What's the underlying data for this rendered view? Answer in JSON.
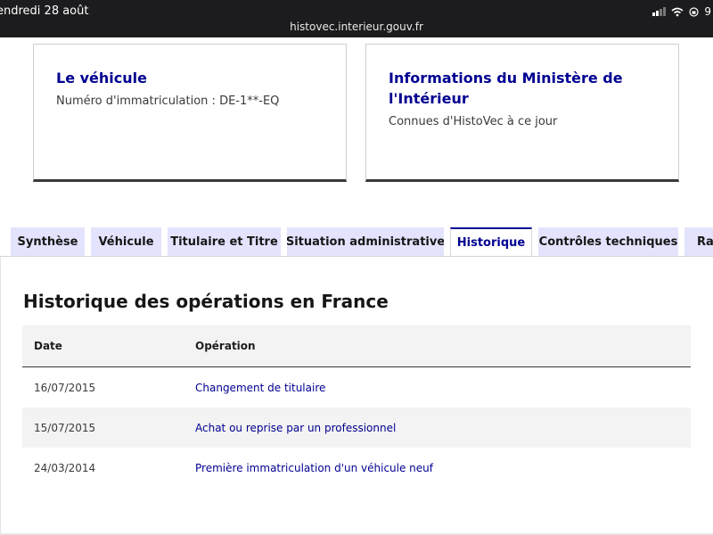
{
  "statusbar": {
    "time": "endredi 28 août",
    "url": "histovec.interieur.gouv.fr",
    "battery": "9"
  },
  "cards": [
    {
      "title": "Le véhicule",
      "text": "Numéro d'immatriculation : DE-1**-EQ"
    },
    {
      "title": "Informations du Ministère de l'Intérieur",
      "text": "Connues d'HistoVec à ce jour"
    }
  ],
  "tabs": [
    {
      "label": "Synthèse",
      "active": false
    },
    {
      "label": "Véhicule",
      "active": false
    },
    {
      "label": "Titulaire et Titre",
      "active": false
    },
    {
      "label": "Situation administrative",
      "active": false
    },
    {
      "label": "Historique",
      "active": true
    },
    {
      "label": "Contrôles techniques",
      "active": false
    },
    {
      "label": "Ra",
      "active": false
    }
  ],
  "history": {
    "title": "Historique des opérations en France",
    "columns": {
      "date": "Date",
      "operation": "Opération"
    },
    "rows": [
      {
        "date": "16/07/2015",
        "operation": "Changement de titulaire"
      },
      {
        "date": "15/07/2015",
        "operation": "Achat ou reprise par un professionnel"
      },
      {
        "date": "24/03/2014",
        "operation": "Première immatriculation d'un véhicule neuf"
      }
    ]
  },
  "colors": {
    "brand_blue": "#000091",
    "tab_bg": "#e3e3fd",
    "status_bg": "#1c1c1e"
  },
  "icons": [
    "signal-icon",
    "wifi-icon",
    "orientation-lock-icon"
  ]
}
